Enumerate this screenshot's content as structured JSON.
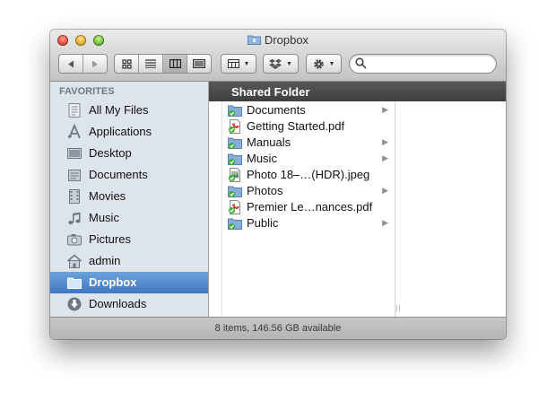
{
  "window": {
    "title": "Dropbox"
  },
  "toolbar": {
    "back_icon": "back-icon",
    "forward_icon": "forward-icon",
    "view_modes": [
      "icon-view-icon",
      "list-view-icon",
      "column-view-icon",
      "cover-flow-icon"
    ],
    "selected_view": "column",
    "arrange_icon": "arrange-icon",
    "dropbox_icon": "dropbox-icon",
    "action_icon": "gear-icon",
    "search": {
      "value": "",
      "placeholder": ""
    }
  },
  "sidebar": {
    "header": "FAVORITES",
    "items": [
      {
        "label": "All My Files",
        "icon": "all-files-icon"
      },
      {
        "label": "Applications",
        "icon": "applications-icon"
      },
      {
        "label": "Desktop",
        "icon": "desktop-icon"
      },
      {
        "label": "Documents",
        "icon": "documents-icon"
      },
      {
        "label": "Movies",
        "icon": "movies-icon"
      },
      {
        "label": "Music",
        "icon": "music-icon"
      },
      {
        "label": "Pictures",
        "icon": "pictures-icon"
      },
      {
        "label": "admin",
        "icon": "home-icon"
      },
      {
        "label": "Dropbox",
        "icon": "folder-icon",
        "selected": true
      },
      {
        "label": "Downloads",
        "icon": "downloads-icon"
      }
    ]
  },
  "column_header": "Shared Folder",
  "files": [
    {
      "name": "Documents",
      "kind": "folder",
      "has_children": true
    },
    {
      "name": "Getting Started.pdf",
      "kind": "pdf",
      "has_children": false
    },
    {
      "name": "Manuals",
      "kind": "folder",
      "has_children": true
    },
    {
      "name": "Music",
      "kind": "folder",
      "has_children": true
    },
    {
      "name": "Photo 18–…(HDR).jpeg",
      "kind": "image",
      "has_children": false
    },
    {
      "name": "Photos",
      "kind": "folder",
      "has_children": true
    },
    {
      "name": "Premier Le…nances.pdf",
      "kind": "pdf",
      "has_children": false
    },
    {
      "name": "Public",
      "kind": "folder",
      "has_children": true
    }
  ],
  "status": "8 items, 146.56 GB available",
  "colors": {
    "selection": "#4a84cc",
    "sidebar_bg": "#dde4ec",
    "folder_blue": "#86aed9",
    "sync_green": "#3fae35",
    "pdf_red": "#c7261e"
  }
}
